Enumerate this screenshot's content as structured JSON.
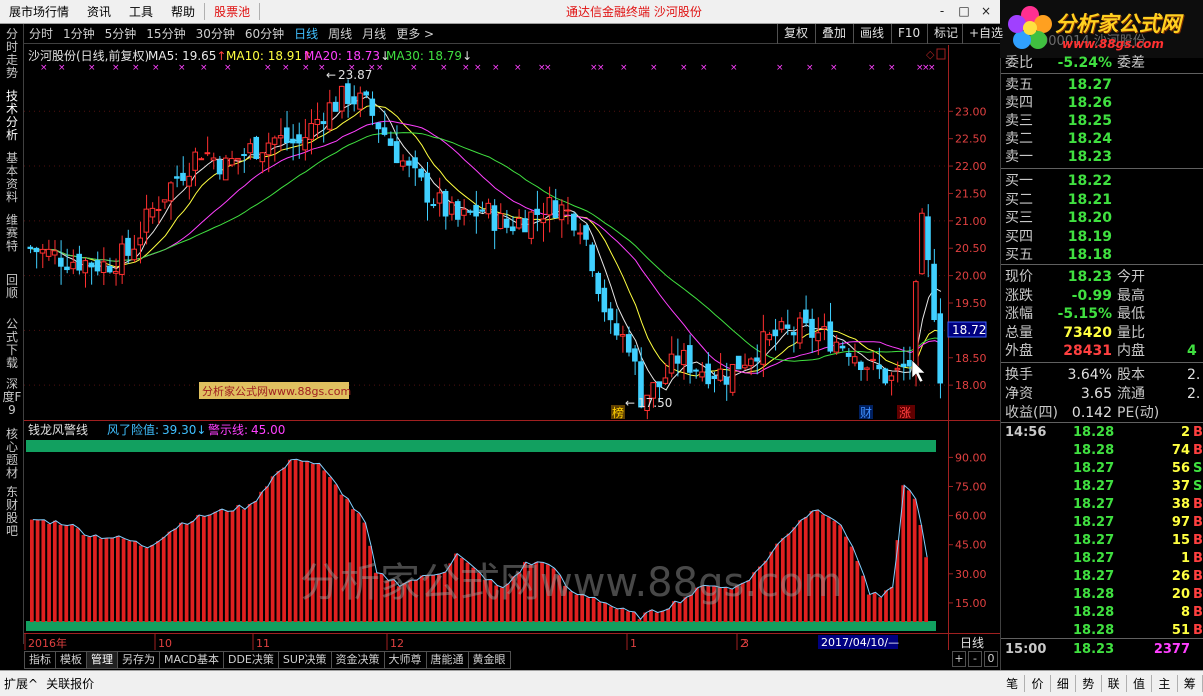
{
  "menu": {
    "items": [
      "展市场行情",
      "资讯",
      "工具",
      "帮助"
    ],
    "highlight": "股票池",
    "title": "通达信金融终端  沙河股份",
    "controls": [
      "-",
      "□",
      "×"
    ]
  },
  "logo": {
    "text": "分析家公式网",
    "url": "www.88gs.com",
    "bg_text": "000014 沙河股份"
  },
  "left_tabs": [
    "分时走势",
    "技术分析",
    "基本资料",
    "维赛特",
    "回顺",
    "公式下载",
    "深度F9",
    "核心题材",
    "东财股吧"
  ],
  "period_bar": {
    "items": [
      "分时",
      "1分钟",
      "5分钟",
      "15分钟",
      "30分钟",
      "60分钟",
      "日线",
      "周线",
      "月线",
      "更多 >"
    ],
    "active": "日线",
    "right_buttons": [
      "复权",
      "叠加",
      "画线",
      "F10",
      "标记",
      "+自选"
    ]
  },
  "main_chart": {
    "legend_title": "沙河股份(日线,前复权)",
    "ma": [
      {
        "name": "MA5",
        "value": "19.65",
        "arrow": "↑",
        "color": "#e8e8e8"
      },
      {
        "name": "MA10",
        "value": "18.91",
        "arrow": "↑",
        "color": "#ffff40"
      },
      {
        "name": "MA20",
        "value": "18.73",
        "arrow": "↓",
        "color": "#ff40ff"
      },
      {
        "name": "MA30",
        "value": "18.79",
        "arrow": "↓",
        "color": "#40e040"
      }
    ],
    "y_ticks": [
      "23.00",
      "22.50",
      "22.00",
      "21.50",
      "21.00",
      "20.50",
      "20.00",
      "19.50",
      "19.00",
      "18.50",
      "18.00"
    ],
    "price_range": [
      17.4,
      23.9
    ],
    "current_price_label": "18.72",
    "high_label": "23.87",
    "low_label": "17.50",
    "markers": [
      {
        "text": "榜",
        "color": "#ffd000"
      },
      {
        "text": "财",
        "color": "#4090ff"
      },
      {
        "text": "涨",
        "color": "#ff4040"
      }
    ],
    "watermark_box": "分析家公式网www.88gs.com"
  },
  "indicator": {
    "name": "钱龙风警线",
    "fields": [
      {
        "label": "风了险值:",
        "value": "39.30",
        "arrow": "↓",
        "color": "#40c0ff"
      },
      {
        "label": "警示线:",
        "value": "45.00",
        "color": "#ff40ff"
      }
    ],
    "y_ticks": [
      "90.00",
      "75.00",
      "60.00",
      "45.00",
      "30.00",
      "15.00"
    ],
    "range": [
      0,
      100
    ],
    "watermark": "分析家公式网www.88gs.com"
  },
  "x_axis": {
    "labels": [
      "2016年",
      "10",
      "11",
      "12",
      "1",
      "2",
      "3"
    ],
    "cursor_date": "2017/04/10/—",
    "period": "日线"
  },
  "bottom_tabs": {
    "items": [
      "指标",
      "模板",
      "管理",
      "另存为",
      "MACD基本",
      "DDE决策",
      "SUP决策",
      "资金决策",
      "大师尊",
      "唐能通",
      "黄金眼"
    ],
    "active": "管理",
    "zoom": [
      "+",
      "-",
      "0"
    ]
  },
  "bottom_strip": [
    "扩展^",
    "关联报价"
  ],
  "quote": {
    "weibi": {
      "label": "委比",
      "value": "-5.24%",
      "label2": "委差",
      "color": "#40e040"
    },
    "asks": [
      {
        "label": "卖五",
        "price": "18.27"
      },
      {
        "label": "卖四",
        "price": "18.26"
      },
      {
        "label": "卖三",
        "price": "18.25"
      },
      {
        "label": "卖二",
        "price": "18.24"
      },
      {
        "label": "卖一",
        "price": "18.23"
      }
    ],
    "bids": [
      {
        "label": "买一",
        "price": "18.22"
      },
      {
        "label": "买二",
        "price": "18.21"
      },
      {
        "label": "买三",
        "price": "18.20"
      },
      {
        "label": "买四",
        "price": "18.19"
      },
      {
        "label": "买五",
        "price": "18.18"
      }
    ],
    "stats": [
      {
        "label": "现价",
        "value": "18.23",
        "color": "#40e040",
        "label2": "今开",
        "value2": ""
      },
      {
        "label": "涨跌",
        "value": "-0.99",
        "color": "#40e040",
        "label2": "最高",
        "value2": ""
      },
      {
        "label": "涨幅",
        "value": "-5.15%",
        "color": "#40e040",
        "label2": "最低",
        "value2": ""
      },
      {
        "label": "总量",
        "value": "73420",
        "color": "#ffff40",
        "label2": "量比",
        "value2": ""
      },
      {
        "label": "外盘",
        "value": "28431",
        "color": "#ff4040",
        "label2": "内盘",
        "value2": "4"
      }
    ],
    "stats2": [
      {
        "label": "换手",
        "value": "3.64%",
        "color": "#e0e0e0",
        "label2": "股本",
        "value2": "2."
      },
      {
        "label": "净资",
        "value": "3.65",
        "color": "#e0e0e0",
        "label2": "流通",
        "value2": "2."
      },
      {
        "label": "收益(四)",
        "value": "0.142",
        "color": "#e0e0e0",
        "label2": "PE(动)",
        "value2": ""
      }
    ]
  },
  "ticks": [
    {
      "time": "14:56",
      "price": "18.28",
      "vol": "2",
      "side": "B"
    },
    {
      "time": "",
      "price": "18.28",
      "vol": "74",
      "side": "B"
    },
    {
      "time": "",
      "price": "18.27",
      "vol": "56",
      "side": "S"
    },
    {
      "time": "",
      "price": "18.27",
      "vol": "37",
      "side": "S"
    },
    {
      "time": "",
      "price": "18.27",
      "vol": "38",
      "side": "B"
    },
    {
      "time": "",
      "price": "18.27",
      "vol": "97",
      "side": "B"
    },
    {
      "time": "",
      "price": "18.27",
      "vol": "15",
      "side": "B"
    },
    {
      "time": "",
      "price": "18.27",
      "vol": "1",
      "side": "B"
    },
    {
      "time": "",
      "price": "18.27",
      "vol": "26",
      "side": "B"
    },
    {
      "time": "",
      "price": "18.28",
      "vol": "20",
      "side": "B"
    },
    {
      "time": "",
      "price": "18.28",
      "vol": "8",
      "side": "B"
    },
    {
      "time": "",
      "price": "18.28",
      "vol": "51",
      "side": "B"
    }
  ],
  "last_tick": {
    "time": "15:00",
    "price": "18.23",
    "vol": "2377"
  },
  "right_bottom": [
    "笔",
    "价",
    "细",
    "势",
    "联",
    "值",
    "主",
    "筹"
  ]
}
